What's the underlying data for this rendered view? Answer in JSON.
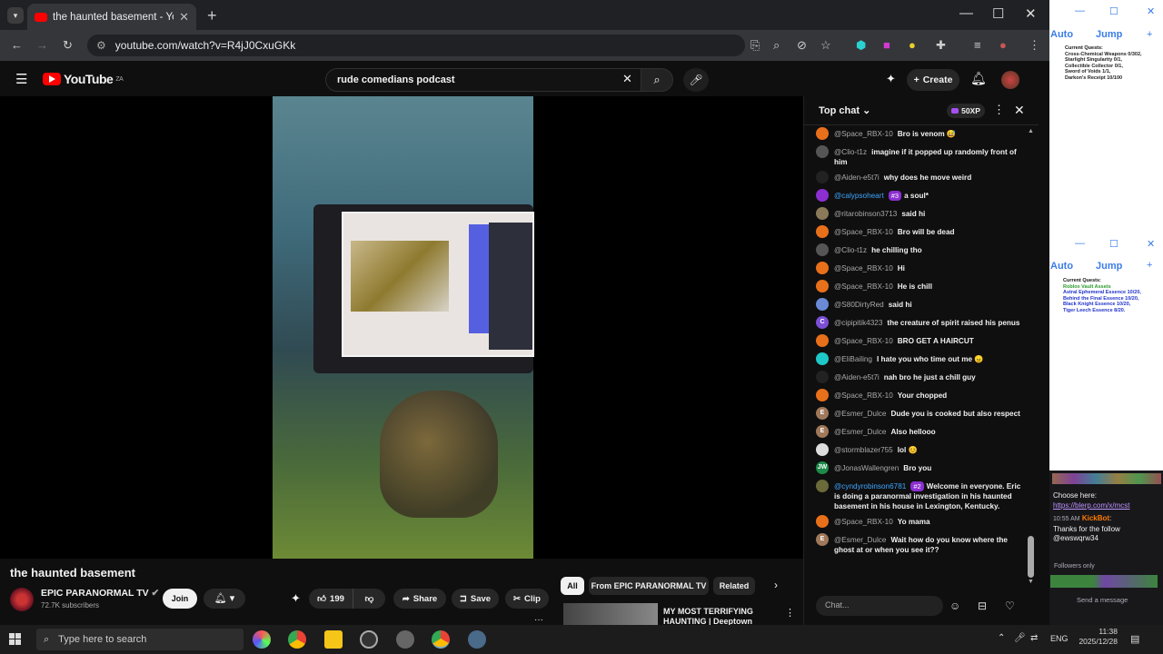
{
  "browser": {
    "tab_title": "the haunted basement - Yo",
    "url": "youtube.com/watch?v=R4jJ0CxuGKk",
    "tablist_icon": "chevron-down-icon",
    "new_tab": "+",
    "close_tab": "✕",
    "minimize": "—",
    "maximize": "☐",
    "close": "✕"
  },
  "youtube": {
    "logo_text": "YouTube",
    "logo_region": "ZA",
    "search_value": "rude comedians podcast",
    "search_clear": "✕",
    "create_label": "Create"
  },
  "video": {
    "title": "the haunted basement",
    "channel": "EPIC PARANORMAL TV",
    "subscribers": "72.7K subscribers",
    "join_label": "Join",
    "like_count": "199",
    "share_label": "Share",
    "save_label": "Save",
    "clip_label": "Clip",
    "more": "···"
  },
  "related": {
    "chips": [
      "All",
      "From EPIC PARANORMAL TV",
      "Related"
    ],
    "rec_title": "MY MOST TERRIFYING HAUNTING | Deeptown School"
  },
  "chat": {
    "title": "Top chat",
    "xp": "50XP",
    "input_placeholder": "Chat...",
    "messages": [
      {
        "author": "@Space_RBX-10",
        "text": "Bro is venom 😅",
        "avatar_color": "#e8701a"
      },
      {
        "author": "@Clio-t1z",
        "text": "imagine if it popped up randomly front of him",
        "avatar_color": "#555"
      },
      {
        "author": "@Aiden-e5t7i",
        "text": "why does he move weird",
        "avatar_color": "#222"
      },
      {
        "author": "@calypsoheart",
        "badge": "#3",
        "text": "a soul*",
        "avatar_color": "#8b2fd1",
        "owner": true
      },
      {
        "author": "@ritarobinson3713",
        "text": "said hi",
        "avatar_color": "#8a7a5a"
      },
      {
        "author": "@Space_RBX-10",
        "text": "Bro will be dead",
        "avatar_color": "#e8701a"
      },
      {
        "author": "@Clio-t1z",
        "text": "he chilling tho",
        "avatar_color": "#555"
      },
      {
        "author": "@Space_RBX-10",
        "text": "Hi",
        "avatar_color": "#e8701a"
      },
      {
        "author": "@Space_RBX-10",
        "text": "He is chill",
        "avatar_color": "#e8701a"
      },
      {
        "author": "@S80DirtyRed",
        "text": "said hi",
        "avatar_color": "#6a8ad6"
      },
      {
        "author": "@cipipitik4323",
        "text": "the creature of spirit raised his penus",
        "avatar_color": "#7b4fd6",
        "initial": "C"
      },
      {
        "author": "@Space_RBX-10",
        "text": "BRO GET A HAIRCUT",
        "avatar_color": "#e8701a"
      },
      {
        "author": "@EliBailing",
        "text": "I hate you who time out me 😠",
        "avatar_color": "#1ec8c8"
      },
      {
        "author": "@Aiden-e5t7i",
        "text": "nah bro he just a chill guy",
        "avatar_color": "#222"
      },
      {
        "author": "@Space_RBX-10",
        "text": "Your chopped",
        "avatar_color": "#e8701a"
      },
      {
        "author": "@Esmer_Dulce",
        "text": "Dude you is cooked but also respect",
        "avatar_color": "#a0785a",
        "initial": "E"
      },
      {
        "author": "@Esmer_Dulce",
        "text": "Also hellooo",
        "avatar_color": "#a0785a",
        "initial": "E"
      },
      {
        "author": "@stormblazer755",
        "text": "lol 😊",
        "avatar_color": "#ddd"
      },
      {
        "author": "@JonasWallengren",
        "text": "Bro you",
        "avatar_color": "#1e8a4a",
        "initial": "JW"
      },
      {
        "author": "@cyndyrobinson6781",
        "badge": "#2",
        "text": "Welcome in everyone. Eric is doing a paranormal investigation in his haunted basement in his house in Lexington, Kentucky.",
        "avatar_color": "#6a6a3a",
        "owner": true
      },
      {
        "author": "@Space_RBX-10",
        "text": "Yo mama",
        "avatar_color": "#e8701a"
      },
      {
        "author": "@Esmer_Dulce",
        "text": "Wait how do you know where the ghost at or when you see it??",
        "avatar_color": "#a0785a",
        "initial": "E"
      }
    ]
  },
  "side_panels": {
    "auto": "Auto",
    "jump": "Jump",
    "quest1_title": "Current Quests:",
    "quest1_lines": [
      "Cross-Chemical Weapons 0/302,",
      "Starlight Singularity 0/1,",
      "Collectible Collector 0/1,",
      "Sword of Voids 1/1,",
      "Darkon's Receipt 10/100"
    ],
    "quest2_title": "Current Quests:",
    "quest2_lines": [
      "Roblox Vault Assets",
      "Astral Ephemeral Essence 10/20,",
      "Behind the Final Essence 10/20,",
      "Black Knight Essence 10/20,",
      "Tiger Leech Essence 8/20."
    ],
    "chat_choose": "Choose here:",
    "chat_link": "https://blerp.com/x/mcst",
    "chat_time": "10:55 AM",
    "chat_user": "KickBot",
    "chat_text": "Thanks for the follow @ewswqrw34",
    "followers_only": "Followers only",
    "send_message": "Send a message"
  },
  "taskbar": {
    "search_placeholder": "Type here to search",
    "lang": "ENG",
    "time": "11:38",
    "date": "2025/12/28"
  }
}
